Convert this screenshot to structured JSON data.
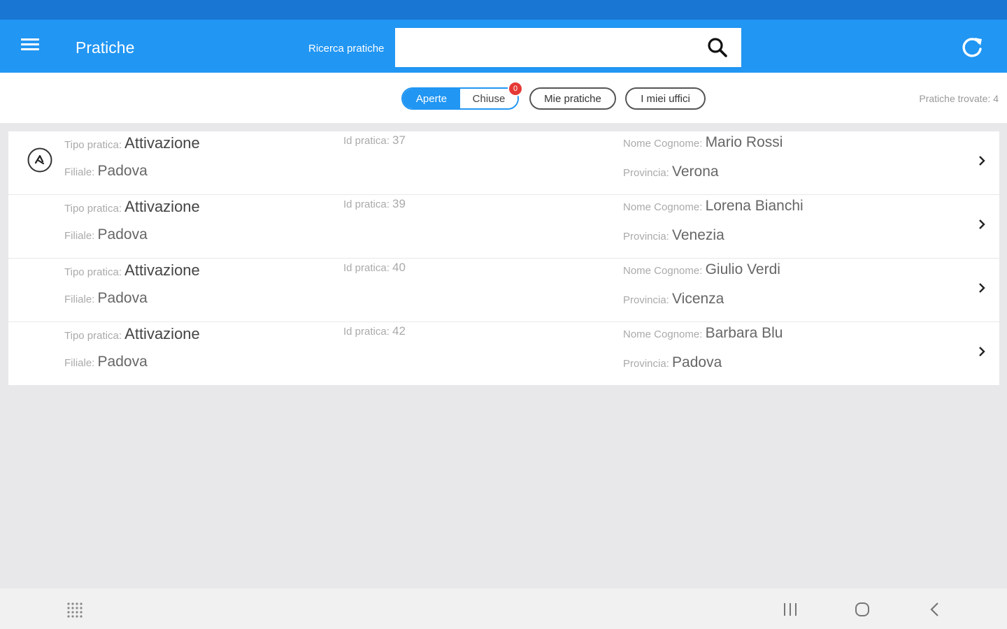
{
  "app_bar": {
    "title": "Pratiche",
    "search_label": "Ricerca pratiche",
    "search_value": ""
  },
  "filters": {
    "open_label": "Aperte",
    "closed_label": "Chiuse",
    "closed_badge": "0",
    "mine_label": "Mie pratiche",
    "offices_label": "I miei uffici",
    "found_label": "Pratiche trovate: 4"
  },
  "labels": {
    "tipo": "Tipo pratica:",
    "filiale": "Filiale:",
    "id": "Id pratica:",
    "nome": "Nome Cognome:",
    "provincia": "Provincia:"
  },
  "rows": [
    {
      "tipo": "Attivazione",
      "filiale": "Padova",
      "id": "37",
      "nome": "Mario Rossi",
      "provincia": "Verona"
    },
    {
      "tipo": "Attivazione",
      "filiale": "Padova",
      "id": "39",
      "nome": "Lorena Bianchi",
      "provincia": "Venezia"
    },
    {
      "tipo": "Attivazione",
      "filiale": "Padova",
      "id": "40",
      "nome": "Giulio Verdi",
      "provincia": "Vicenza"
    },
    {
      "tipo": "Attivazione",
      "filiale": "Padova",
      "id": "42",
      "nome": "Barbara Blu",
      "provincia": "Padova"
    }
  ],
  "colors": {
    "primary": "#2196f3",
    "status_bar": "#1976d2",
    "badge": "#e53935"
  },
  "icons": [
    "menu-icon",
    "search-icon",
    "refresh-icon",
    "avatar-icon",
    "chevron-right-icon",
    "apps-grid-icon",
    "recents-icon",
    "home-icon",
    "back-icon"
  ]
}
